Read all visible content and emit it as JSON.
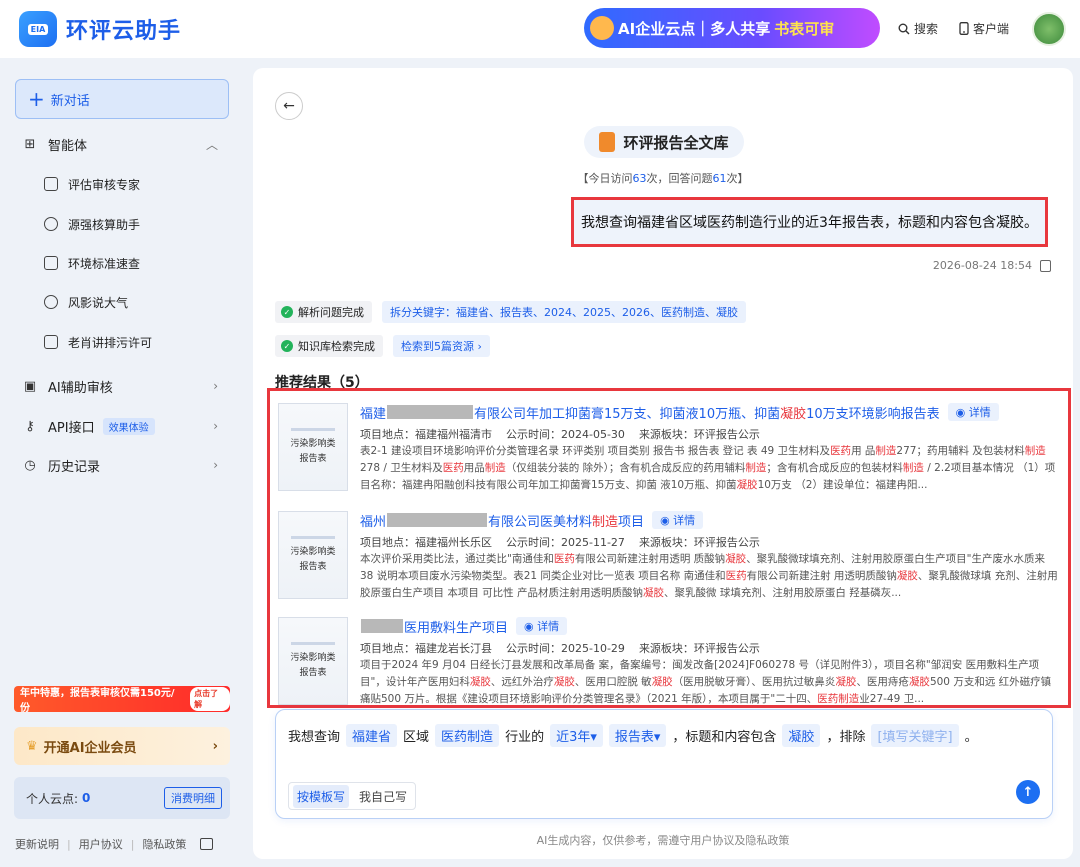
{
  "app": {
    "logo_text": "EIA",
    "brand": "环评云助手",
    "banner": {
      "part1": "AI企业云点｜多人共享",
      "part2": "书表可审"
    },
    "search_label": "搜索",
    "client_label": "客户端"
  },
  "sidebar": {
    "new_chat": "新对话",
    "agents_label": "智能体",
    "agents": [
      {
        "label": "评估审核专家"
      },
      {
        "label": "源强核算助手"
      },
      {
        "label": "环境标准速查"
      },
      {
        "label": "风影说大气"
      },
      {
        "label": "老肖讲排污许可"
      }
    ],
    "ai_review": "AI辅助审核",
    "api_label": "API接口",
    "api_badge": "效果体验",
    "history": "历史记录",
    "promo_text": "年中特惠，报告表审核仅需150元/份",
    "promo_btn": "点击了解",
    "vip": "开通AI企业会员",
    "points_label": "个人云点:",
    "points_value": "0",
    "points_btn": "消费明细",
    "footer": [
      "更新说明",
      "用户协议",
      "隐私政策"
    ]
  },
  "main": {
    "lib_title": "环评报告全文库",
    "stats": {
      "prefix": "【今日访问",
      "visits": "63",
      "mid": "次，回答问题",
      "answers": "61",
      "suffix": "次】"
    },
    "user_message": "我想查询福建省区域医药制造行业的近3年报告表，标题和内容包含凝胶。",
    "message_time": "2026-08-24 18:54",
    "step1": {
      "status": "解析问题完成",
      "detail": "拆分关键字：福建省、报告表、2024、2025、2026、医药制造、凝胶"
    },
    "step2": {
      "status": "知识库检索完成",
      "detail": "检索到5篇资源 ›"
    },
    "results_title": "推荐结果（5）",
    "detail_label": "详情",
    "thumb_text": [
      "污染影响类",
      "报告表"
    ],
    "results": [
      {
        "title_prefix": "福建",
        "title_mid": "有限公司年加工抑菌膏15万支、抑菌液10万瓶、抑菌",
        "title_kw": "凝胶",
        "title_suffix": "10万支环境影响报告表",
        "location": "项目地点：福建福州福清市",
        "date": "公示时间：2024-05-30",
        "source": "来源板块：环评报告公示",
        "snippet": "表2-1 建设项目环境影响评价分类管理名录 环评类别 项目类别 报告书 报告表 登记 表 49 卫生材料及医药用 品制造277；药用辅料 及包装材料制造278 / 卫生材料及医药用品制造（仅组装分装的 除外）；含有机合成反应的药用辅料制造；含有机合成反应的包装材料制造 / 2.2项目基本情况 （1）项目名称：福建冉阳融创科技有限公司年加工抑菌膏15万支、抑菌 液10万瓶、抑菌凝胶10万支 （2）建设单位：福建冉阳..."
      },
      {
        "title_prefix": "福州",
        "title_mid": "有限公司医美材料",
        "title_kw": "制造",
        "title_suffix": "项目",
        "location": "项目地点：福建福州长乐区",
        "date": "公示时间：2025-11-27",
        "source": "来源板块：环评报告公示",
        "snippet": "本次评价采用类比法，通过类比\"南通佳和医药有限公司新建注射用透明 质酸钠凝胶、聚乳酸微球填充剂、注射用胶原蛋白生产项目\"生产废水水质来 38 说明本项目废水污染物类型。表21 同类企业对比一览表 项目名称 南通佳和医药有限公司新建注射 用透明质酸钠凝胶、聚乳酸微球填 充剂、注射用胶原蛋白生产项目 本项目 可比性 产品材质注射用透明质酸钠凝胶、聚乳酸微 球填充剂、注射用胶原蛋白 羟基磷灰..."
      },
      {
        "title_prefix": "",
        "title_mid": "医用敷料生产项目",
        "title_kw": "",
        "title_suffix": "",
        "location": "项目地点：福建龙岩长汀县",
        "date": "公示时间：2025-10-29",
        "source": "来源板块：环评报告公示",
        "snippet": "项目于2024 年9 月04 日经长汀县发展和改革局备 案，备案编号：闽发改备[2024]F060278 号（详见附件3），项目名称\"邹润安 医用敷料生产项目\"，设计年产医用妇科凝胶、远红外治疗凝胶、医用口腔脱 敏凝胶（医用脱敏牙膏）、医用抗过敏鼻炎凝胶、医用痔疮凝胶500 万支和远 红外磁疗镇痛贴500 万片。根据《建设项目环境影响评价分类管理名录》（2021 年版），本项目属于\"二十四、医药制造业27-49 卫..."
      }
    ],
    "composer": {
      "t1": "我想查询",
      "s1": "福建省",
      "t2": "区域",
      "s2": "医药制造",
      "t3": "行业的",
      "s3": "近3年▾",
      "s4": "报告表▾",
      "t4": "，标题和内容包含",
      "s5": "凝胶",
      "t5": "，排除",
      "s6": "[填写关键字]",
      "t6": "。",
      "mode_template": "按模板写",
      "mode_free": "我自己写"
    },
    "disclaimer": "AI生成内容，仅供参考，需遵守用户协议及隐私政策"
  }
}
